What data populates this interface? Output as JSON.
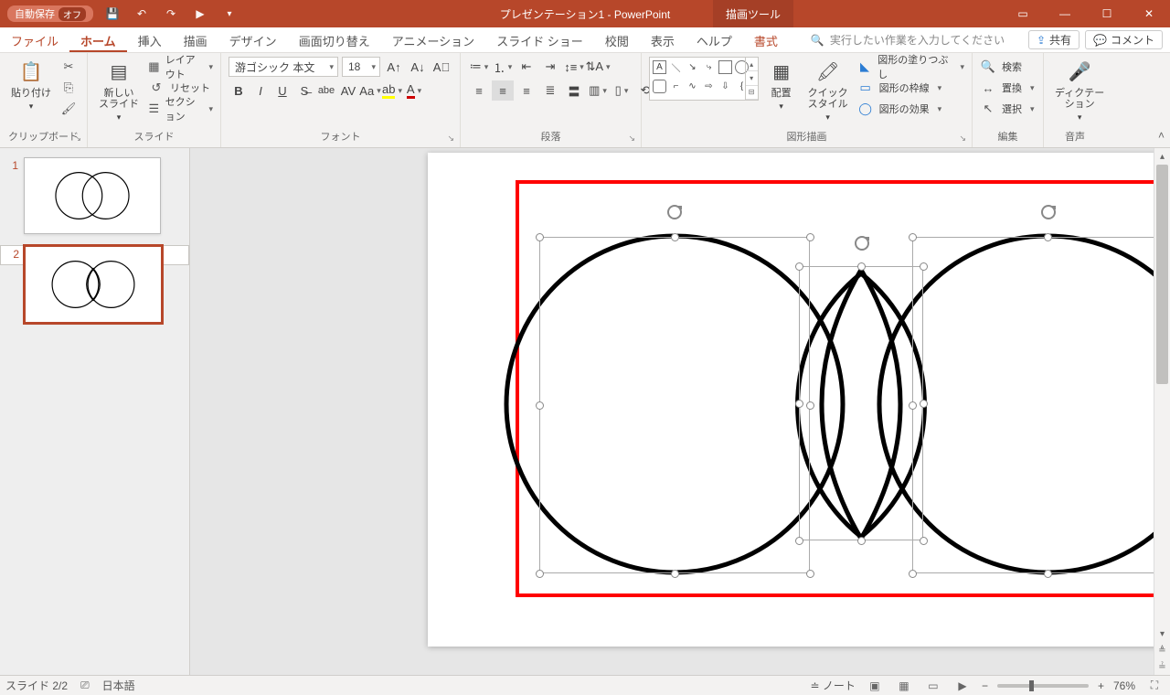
{
  "titlebar": {
    "autosave_label": "自動保存",
    "autosave_state": "オフ",
    "title": "プレゼンテーション1  -  PowerPoint",
    "draw_tools": "描画ツール"
  },
  "tabs": {
    "file": "ファイル",
    "home": "ホーム",
    "insert": "挿入",
    "draw": "描画",
    "design": "デザイン",
    "transitions": "画面切り替え",
    "animations": "アニメーション",
    "slideshow": "スライド ショー",
    "review": "校閲",
    "view": "表示",
    "help": "ヘルプ",
    "format": "書式",
    "tellme": "実行したい作業を入力してください",
    "share": "共有",
    "comments": "コメント"
  },
  "ribbon": {
    "clipboard": {
      "label": "クリップボード",
      "paste": "貼り付け"
    },
    "slides": {
      "label": "スライド",
      "new_slide": "新しい\nスライド",
      "layout": "レイアウト",
      "reset": "リセット",
      "section": "セクション"
    },
    "font": {
      "label": "フォント",
      "fontname": "游ゴシック 本文",
      "fontsize": "18"
    },
    "paragraph": {
      "label": "段落"
    },
    "drawing": {
      "label": "図形描画",
      "arrange": "配置",
      "quickstyles": "クイック\nスタイル",
      "fill": "図形の塗りつぶし",
      "outline": "図形の枠線",
      "effects": "図形の効果"
    },
    "editing": {
      "label": "編集",
      "find": "検索",
      "replace": "置換",
      "select": "選択"
    },
    "voice": {
      "label": "音声",
      "dictate": "ディクテー\nション"
    }
  },
  "status": {
    "slide": "スライド 2/2",
    "lang": "日本語",
    "notes": "ノート",
    "zoom": "76%"
  },
  "slides": [
    {
      "num": "1"
    },
    {
      "num": "2"
    }
  ]
}
